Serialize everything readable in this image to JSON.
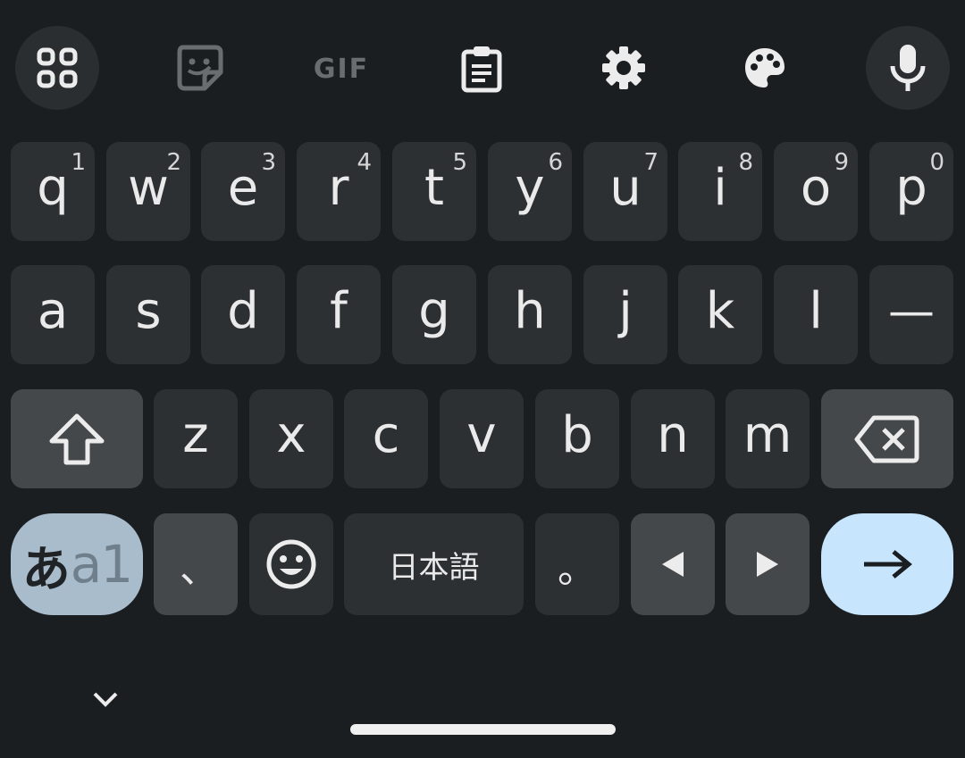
{
  "toolbar": {
    "items": [
      {
        "name": "apps-grid-icon"
      },
      {
        "name": "sticker-icon"
      },
      {
        "name": "gif-icon",
        "label": "GIF"
      },
      {
        "name": "clipboard-icon"
      },
      {
        "name": "settings-gear-icon"
      },
      {
        "name": "theme-palette-icon"
      },
      {
        "name": "microphone-icon"
      }
    ]
  },
  "rows": {
    "row1": [
      {
        "k": "q",
        "h": "1"
      },
      {
        "k": "w",
        "h": "2"
      },
      {
        "k": "e",
        "h": "3"
      },
      {
        "k": "r",
        "h": "4"
      },
      {
        "k": "t",
        "h": "5"
      },
      {
        "k": "y",
        "h": "6"
      },
      {
        "k": "u",
        "h": "7"
      },
      {
        "k": "i",
        "h": "8"
      },
      {
        "k": "o",
        "h": "9"
      },
      {
        "k": "p",
        "h": "0"
      }
    ],
    "row2": [
      "a",
      "s",
      "d",
      "f",
      "g",
      "h",
      "j",
      "k",
      "l",
      "—"
    ],
    "row3": [
      "z",
      "x",
      "c",
      "v",
      "b",
      "n",
      "m"
    ]
  },
  "bottom": {
    "mode_hiragana": "あ",
    "mode_latin": "a1",
    "comma": "、",
    "space": "日本語",
    "period": "。"
  },
  "colors": {
    "background": "#1b1e21",
    "key": "#2d3033",
    "function_key": "#45484b",
    "enter_key": "#c7e5fc",
    "mode_key": "#a9bccc"
  }
}
